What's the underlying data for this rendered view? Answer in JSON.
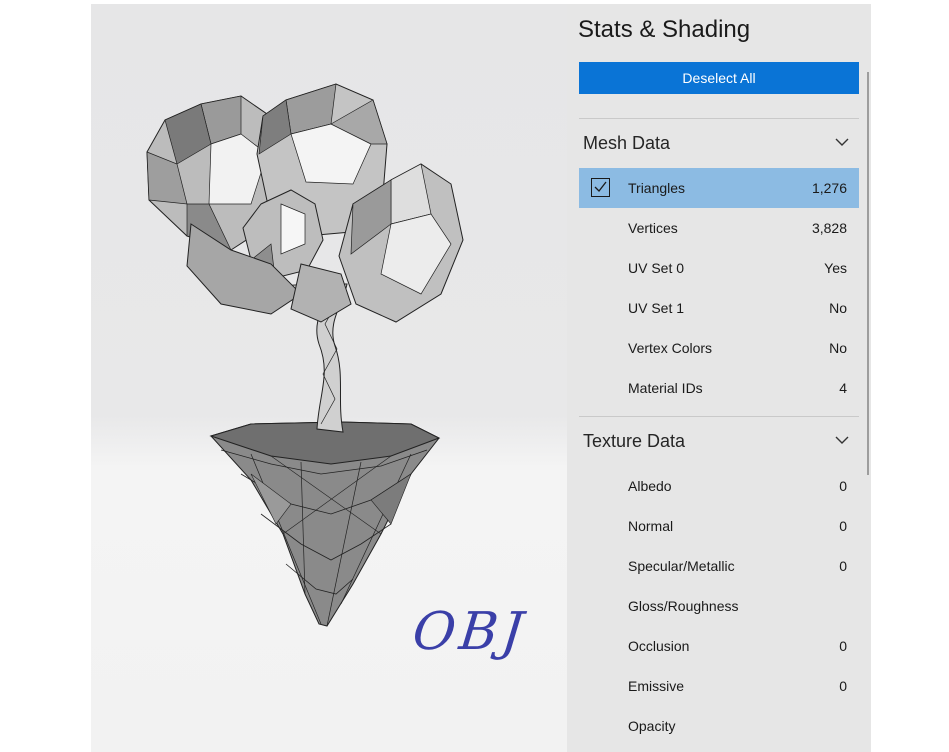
{
  "panel": {
    "title": "Stats & Shading",
    "deselect_label": "Deselect All",
    "mesh_section": {
      "label": "Mesh Data",
      "rows": [
        {
          "name": "Triangles",
          "value": "1,276",
          "selected": true
        },
        {
          "name": "Vertices",
          "value": "3,828"
        },
        {
          "name": "UV Set 0",
          "value": "Yes"
        },
        {
          "name": "UV Set 1",
          "value": "No"
        },
        {
          "name": "Vertex Colors",
          "value": "No"
        },
        {
          "name": "Material IDs",
          "value": "4"
        }
      ]
    },
    "texture_section": {
      "label": "Texture Data",
      "rows": [
        {
          "name": "Albedo",
          "value": "0"
        },
        {
          "name": "Normal",
          "value": "0"
        },
        {
          "name": "Specular/Metallic",
          "value": "0"
        },
        {
          "name": "Gloss/Roughness",
          "value": ""
        },
        {
          "name": "Occlusion",
          "value": "0"
        },
        {
          "name": "Emissive",
          "value": "0"
        },
        {
          "name": "Opacity",
          "value": ""
        }
      ]
    }
  },
  "viewport": {
    "watermark": "OBJ",
    "model_icon": "low-poly-tree-island"
  },
  "colors": {
    "accent_button": "#0a74d6",
    "selected_row": "#8cbbe3",
    "panel_bg": "#e6e6e6"
  }
}
